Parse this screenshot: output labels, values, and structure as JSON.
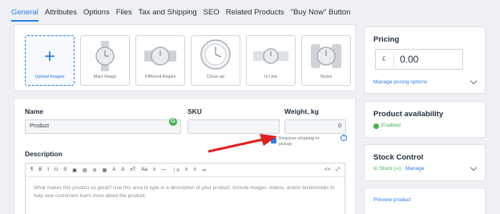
{
  "tabs": [
    {
      "label": "General"
    },
    {
      "label": "Attributes"
    },
    {
      "label": "Options"
    },
    {
      "label": "Files"
    },
    {
      "label": "Tax and Shipping"
    },
    {
      "label": "SEO"
    },
    {
      "label": "Related Products"
    },
    {
      "label": "\"Buy Now\" Button"
    }
  ],
  "images": {
    "upload_label": "Upload Images",
    "slots": [
      {
        "label": "Main Image"
      },
      {
        "label": "Different Angles"
      },
      {
        "label": "Close-up"
      },
      {
        "label": "In Use"
      },
      {
        "label": "Styles"
      }
    ]
  },
  "form": {
    "name_label": "Name",
    "name_value": "Product",
    "sku_label": "SKU",
    "sku_value": "",
    "weight_label": "Weight, kg",
    "weight_value": "0",
    "requires_shipping_label": "Requires shipping or pickup",
    "requires_shipping_checked": true,
    "description_label": "Description",
    "description_placeholder": "What makes this product so great? Use this area to type in a description of your product. Include images, videos, and/or testimonials to help new customers learn more about the product.",
    "toolbar_items": [
      "¶",
      "B",
      "I",
      "U",
      "S",
      "▣",
      "▤",
      "⊖",
      "▦",
      "A",
      "A",
      "±T",
      "Aa",
      "≡",
      "—",
      "⋮≡",
      "≡",
      "≡",
      "⇥",
      "<>",
      "⤢"
    ]
  },
  "pricing": {
    "title": "Pricing",
    "currency": "£",
    "value": "0.00",
    "manage_link": "Manage pricing options"
  },
  "availability": {
    "title": "Product availability",
    "status": "Enabled"
  },
  "stock": {
    "title": "Stock Control",
    "status": "In Stock (∞)",
    "manage_link": "Manage"
  },
  "preview": {
    "link": "Preview product"
  },
  "colors": {
    "accent": "#2b7de9",
    "enabled_green": "#3fb34f",
    "arrow_red": "#e02020"
  }
}
